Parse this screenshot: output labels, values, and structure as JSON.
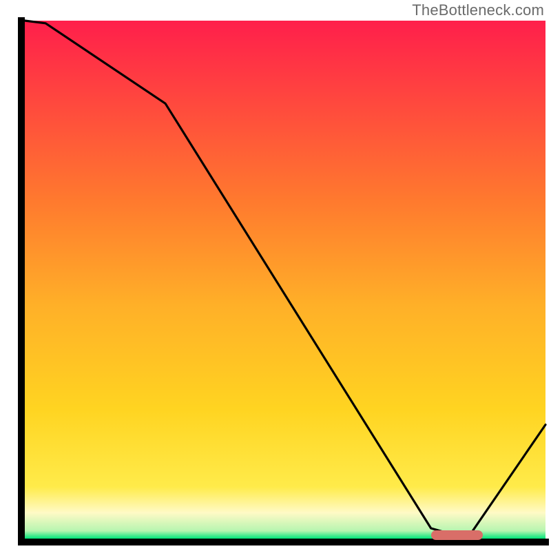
{
  "attribution": "TheBottleneck.com",
  "colors": {
    "gradient_top": "#ff1f4b",
    "gradient_upper": "#ff6a2e",
    "gradient_mid": "#ffd421",
    "gradient_lower_yellow": "#ffeb4a",
    "gradient_pale": "#fffac6",
    "gradient_green": "#00e57a",
    "axis": "#000000",
    "curve": "#000000",
    "marker": "#d96e68"
  },
  "chart_data": {
    "type": "line",
    "title": "",
    "xlabel": "",
    "ylabel": "",
    "xlim": [
      0,
      100
    ],
    "ylim": [
      0,
      100
    ],
    "x": [
      0,
      4,
      27,
      78,
      85,
      100
    ],
    "values": [
      100,
      99.5,
      84,
      2,
      0,
      22
    ],
    "marker_x_range": [
      78,
      88
    ],
    "marker_y": 0.7,
    "gradient_stops_pct": [
      0,
      35,
      55,
      75,
      90,
      95,
      98.5,
      100
    ],
    "gradient_colors": [
      "#ff1f4b",
      "#ff7a2e",
      "#ffb028",
      "#ffd421",
      "#ffeb4a",
      "#fffac6",
      "#b6f5b0",
      "#00e57a"
    ]
  },
  "__notes": "Axis values are normalized 0-100 since the source renders no tick labels. Curve points estimated from pixels. Gradient band is vertical red→orange→yellow→pale→green. Small rounded red marker sits at the curve minimum near x≈78–88."
}
